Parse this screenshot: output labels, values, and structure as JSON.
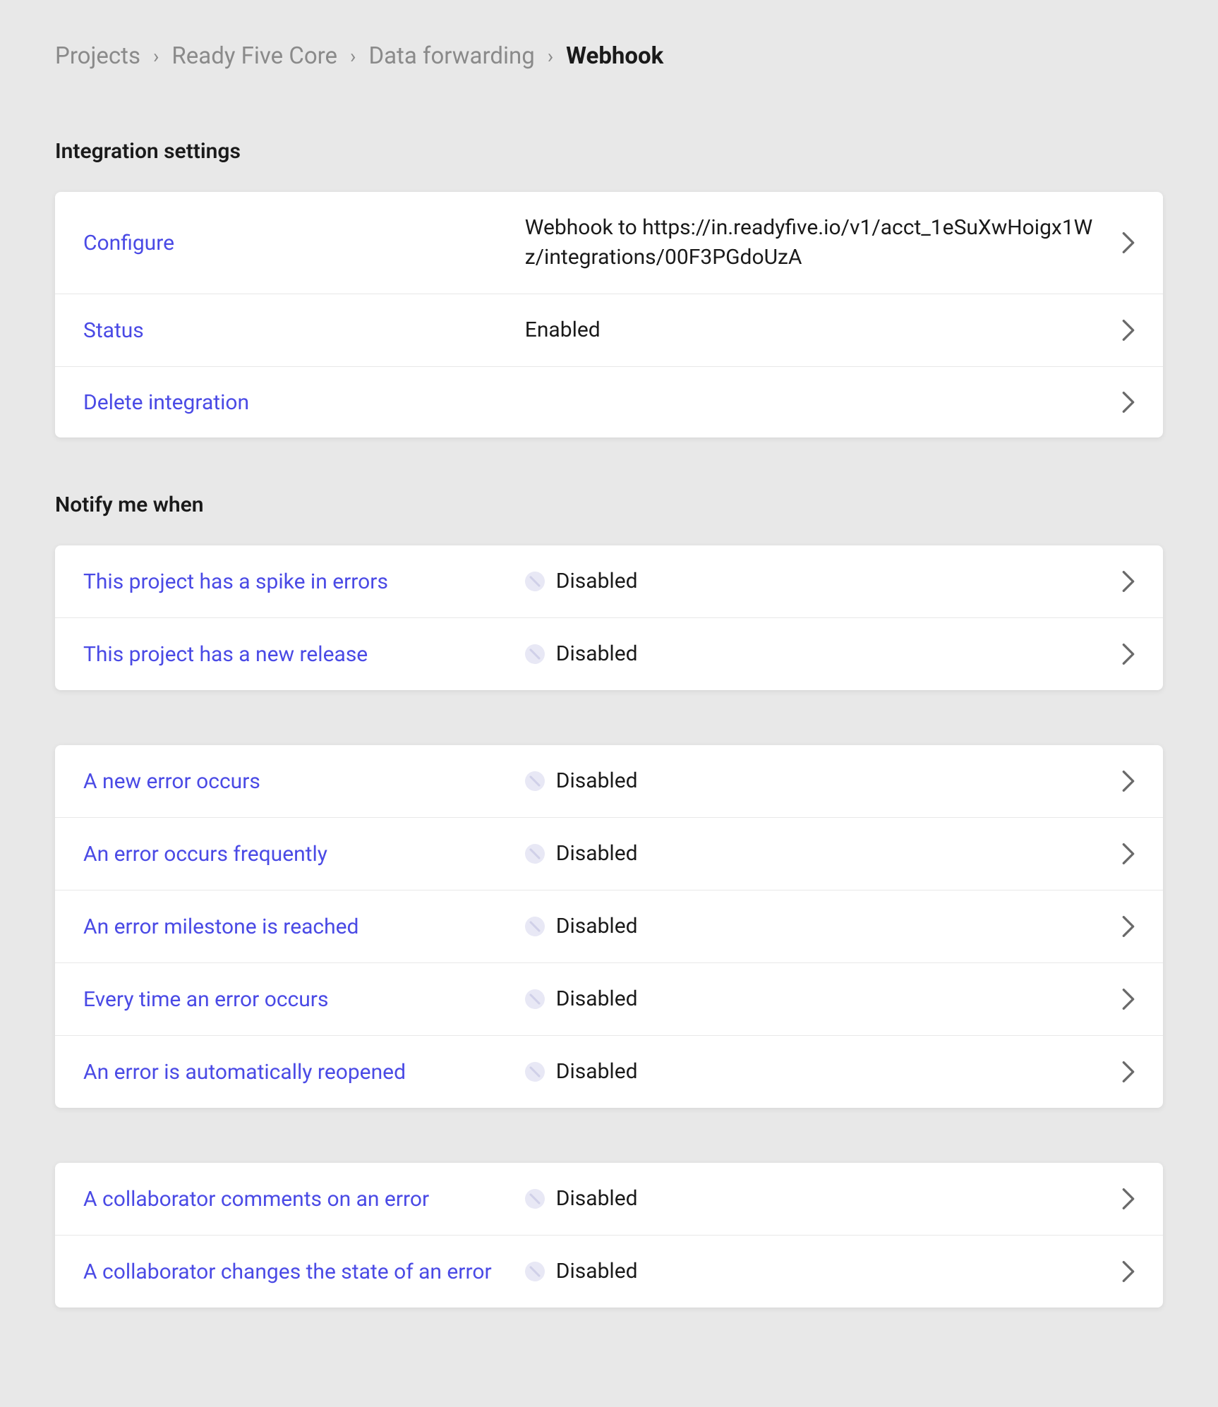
{
  "breadcrumb": {
    "items": [
      {
        "label": "Projects"
      },
      {
        "label": "Ready Five Core"
      },
      {
        "label": "Data forwarding"
      },
      {
        "label": "Webhook"
      }
    ]
  },
  "sections": {
    "integration": {
      "title": "Integration settings",
      "rows": {
        "configure": {
          "label": "Configure",
          "value": "Webhook to https://in.readyfive.io/v1/acct_1eSuXwHoigx1Wz/integrations/00F3PGdoUzA"
        },
        "status": {
          "label": "Status",
          "value": "Enabled"
        },
        "delete": {
          "label": "Delete integration"
        }
      }
    },
    "notify": {
      "title": "Notify me when",
      "group1": [
        {
          "label": "This project has a spike in errors",
          "value": "Disabled"
        },
        {
          "label": "This project has a new release",
          "value": "Disabled"
        }
      ],
      "group2": [
        {
          "label": "A new error occurs",
          "value": "Disabled"
        },
        {
          "label": "An error occurs frequently",
          "value": "Disabled"
        },
        {
          "label": "An error milestone is reached",
          "value": "Disabled"
        },
        {
          "label": "Every time an error occurs",
          "value": "Disabled"
        },
        {
          "label": "An error is automatically reopened",
          "value": "Disabled"
        }
      ],
      "group3": [
        {
          "label": "A collaborator comments on an error",
          "value": "Disabled"
        },
        {
          "label": "A collaborator changes the state of an error",
          "value": "Disabled"
        }
      ]
    }
  }
}
